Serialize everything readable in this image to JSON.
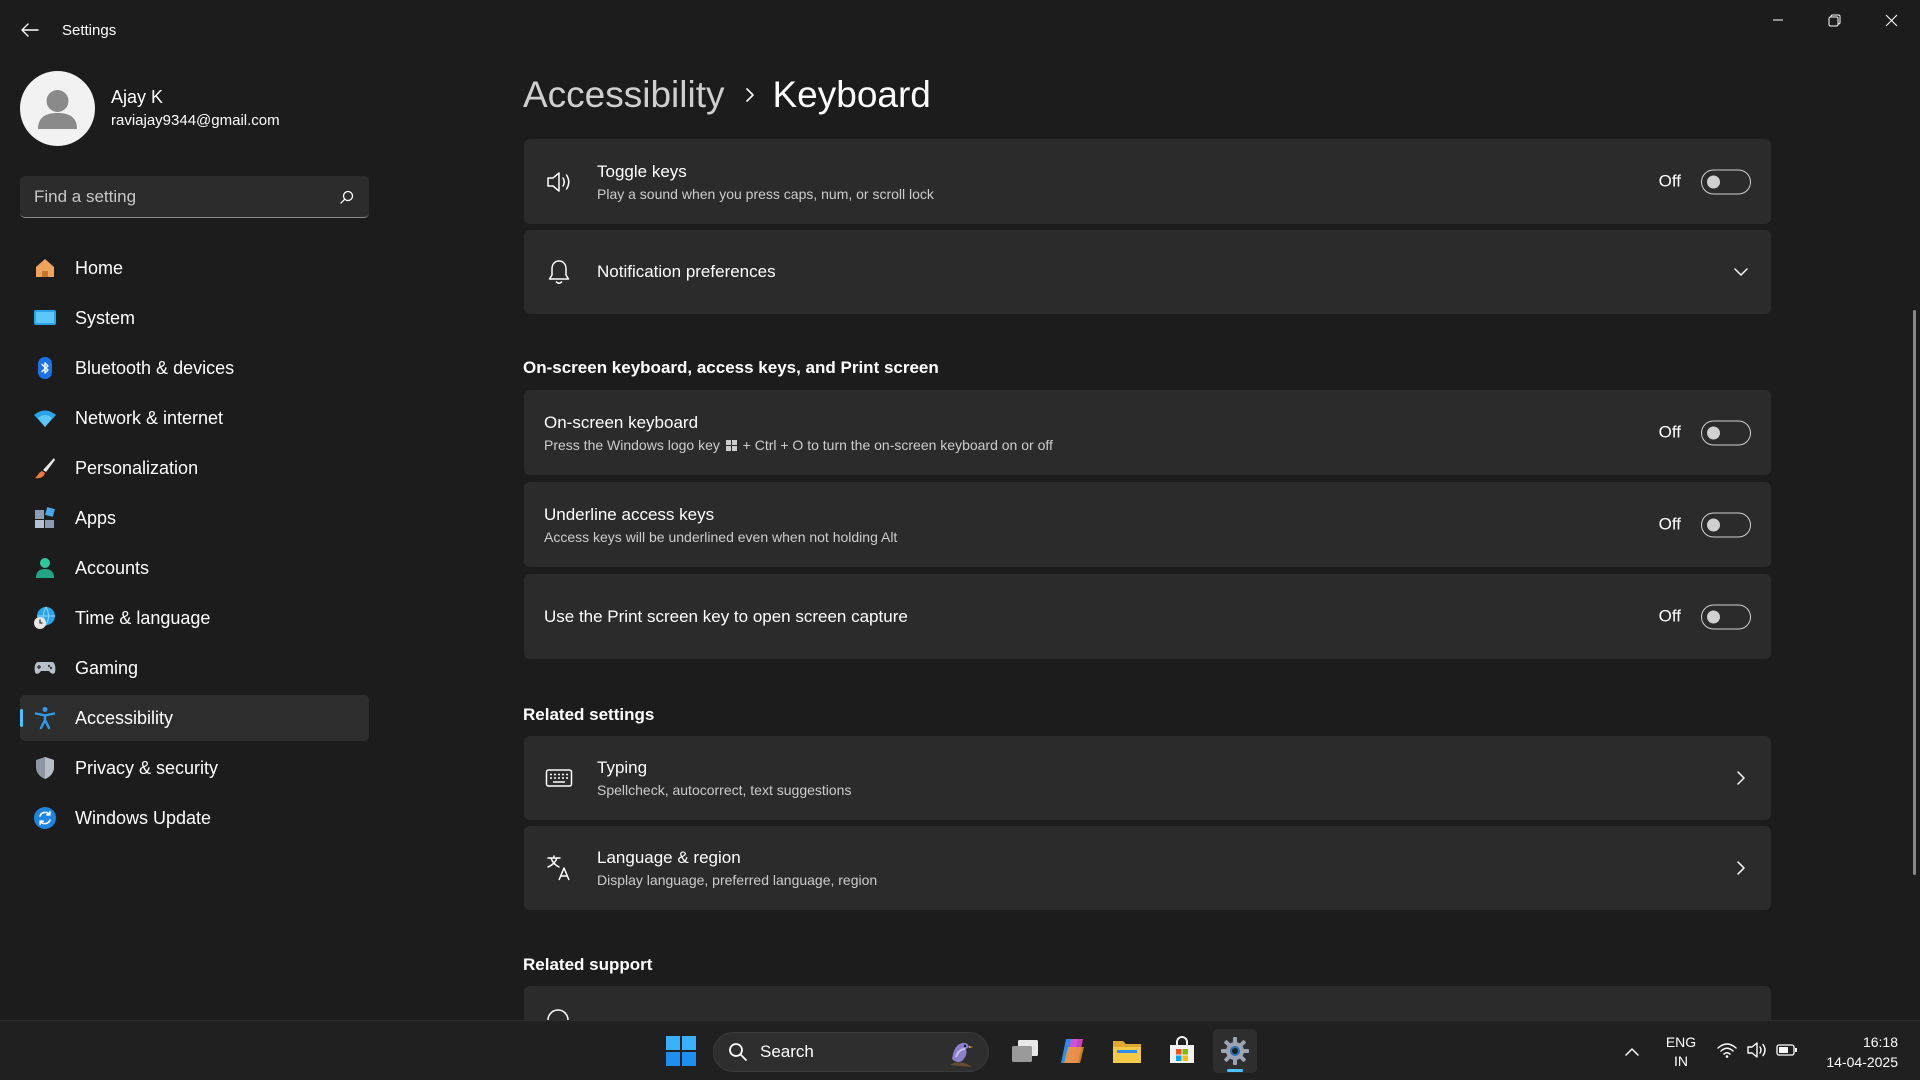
{
  "window": {
    "title": "Settings"
  },
  "profile": {
    "name": "Ajay K",
    "email": "raviajay9344@gmail.com"
  },
  "search": {
    "placeholder": "Find a setting"
  },
  "sidebar": {
    "items": [
      {
        "label": "Home",
        "icon": "home-icon"
      },
      {
        "label": "System",
        "icon": "system-icon"
      },
      {
        "label": "Bluetooth & devices",
        "icon": "bluetooth-icon"
      },
      {
        "label": "Network & internet",
        "icon": "wifi-icon"
      },
      {
        "label": "Personalization",
        "icon": "brush-icon"
      },
      {
        "label": "Apps",
        "icon": "apps-icon"
      },
      {
        "label": "Accounts",
        "icon": "accounts-icon"
      },
      {
        "label": "Time & language",
        "icon": "globe-clock-icon"
      },
      {
        "label": "Gaming",
        "icon": "gamepad-icon"
      },
      {
        "label": "Accessibility",
        "icon": "accessibility-icon",
        "active": true
      },
      {
        "label": "Privacy & security",
        "icon": "shield-icon"
      },
      {
        "label": "Windows Update",
        "icon": "update-icon"
      }
    ]
  },
  "breadcrumb": {
    "parent": "Accessibility",
    "current": "Keyboard"
  },
  "cards": {
    "toggle_keys": {
      "title": "Toggle keys",
      "desc": "Play a sound when you press caps, num, or scroll lock",
      "state": "Off",
      "icon": "speaker-icon"
    },
    "notification_prefs": {
      "title": "Notification preferences",
      "icon": "bell-icon"
    },
    "onscreen_keyboard": {
      "title": "On-screen keyboard",
      "desc_before": "Press the Windows logo key",
      "desc_after": "+ Ctrl + O to turn the on-screen keyboard on or off",
      "state": "Off"
    },
    "underline_access_keys": {
      "title": "Underline access keys",
      "desc": "Access keys will be underlined even when not holding Alt",
      "state": "Off"
    },
    "print_screen": {
      "title": "Use the Print screen key to open screen capture",
      "state": "Off"
    },
    "typing": {
      "title": "Typing",
      "desc": "Spellcheck, autocorrect, text suggestions",
      "icon": "keyboard-icon"
    },
    "language_region": {
      "title": "Language & region",
      "desc": "Display language, preferred language, region",
      "icon": "language-icon"
    }
  },
  "sections": {
    "onscreen": "On-screen keyboard, access keys, and Print screen",
    "related_settings": "Related settings",
    "related_support": "Related support"
  },
  "taskbar": {
    "search_label": "Search",
    "language_line1": "ENG",
    "language_line2": "IN",
    "time": "16:18",
    "date": "14-04-2025"
  },
  "colors": {
    "accent": "#4cc2ff",
    "background": "#1c1c1c",
    "card": "#2b2b2b"
  }
}
